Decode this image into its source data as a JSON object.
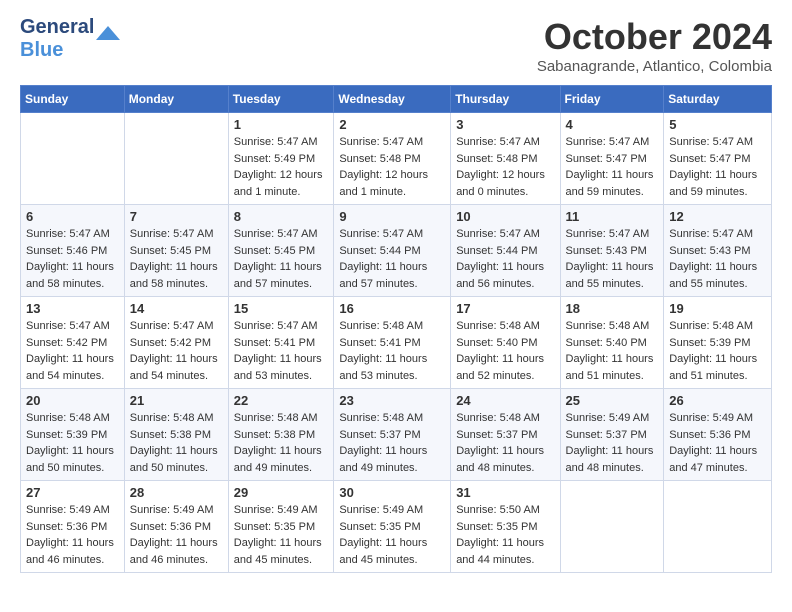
{
  "logo": {
    "line1": "General",
    "line2": "Blue"
  },
  "title": "October 2024",
  "subtitle": "Sabanagrande, Atlantico, Colombia",
  "days_of_week": [
    "Sunday",
    "Monday",
    "Tuesday",
    "Wednesday",
    "Thursday",
    "Friday",
    "Saturday"
  ],
  "weeks": [
    [
      {
        "day": "",
        "sunrise": "",
        "sunset": "",
        "daylight": ""
      },
      {
        "day": "",
        "sunrise": "",
        "sunset": "",
        "daylight": ""
      },
      {
        "day": "1",
        "sunrise": "Sunrise: 5:47 AM",
        "sunset": "Sunset: 5:49 PM",
        "daylight": "Daylight: 12 hours and 1 minute."
      },
      {
        "day": "2",
        "sunrise": "Sunrise: 5:47 AM",
        "sunset": "Sunset: 5:48 PM",
        "daylight": "Daylight: 12 hours and 1 minute."
      },
      {
        "day": "3",
        "sunrise": "Sunrise: 5:47 AM",
        "sunset": "Sunset: 5:48 PM",
        "daylight": "Daylight: 12 hours and 0 minutes."
      },
      {
        "day": "4",
        "sunrise": "Sunrise: 5:47 AM",
        "sunset": "Sunset: 5:47 PM",
        "daylight": "Daylight: 11 hours and 59 minutes."
      },
      {
        "day": "5",
        "sunrise": "Sunrise: 5:47 AM",
        "sunset": "Sunset: 5:47 PM",
        "daylight": "Daylight: 11 hours and 59 minutes."
      }
    ],
    [
      {
        "day": "6",
        "sunrise": "Sunrise: 5:47 AM",
        "sunset": "Sunset: 5:46 PM",
        "daylight": "Daylight: 11 hours and 58 minutes."
      },
      {
        "day": "7",
        "sunrise": "Sunrise: 5:47 AM",
        "sunset": "Sunset: 5:45 PM",
        "daylight": "Daylight: 11 hours and 58 minutes."
      },
      {
        "day": "8",
        "sunrise": "Sunrise: 5:47 AM",
        "sunset": "Sunset: 5:45 PM",
        "daylight": "Daylight: 11 hours and 57 minutes."
      },
      {
        "day": "9",
        "sunrise": "Sunrise: 5:47 AM",
        "sunset": "Sunset: 5:44 PM",
        "daylight": "Daylight: 11 hours and 57 minutes."
      },
      {
        "day": "10",
        "sunrise": "Sunrise: 5:47 AM",
        "sunset": "Sunset: 5:44 PM",
        "daylight": "Daylight: 11 hours and 56 minutes."
      },
      {
        "day": "11",
        "sunrise": "Sunrise: 5:47 AM",
        "sunset": "Sunset: 5:43 PM",
        "daylight": "Daylight: 11 hours and 55 minutes."
      },
      {
        "day": "12",
        "sunrise": "Sunrise: 5:47 AM",
        "sunset": "Sunset: 5:43 PM",
        "daylight": "Daylight: 11 hours and 55 minutes."
      }
    ],
    [
      {
        "day": "13",
        "sunrise": "Sunrise: 5:47 AM",
        "sunset": "Sunset: 5:42 PM",
        "daylight": "Daylight: 11 hours and 54 minutes."
      },
      {
        "day": "14",
        "sunrise": "Sunrise: 5:47 AM",
        "sunset": "Sunset: 5:42 PM",
        "daylight": "Daylight: 11 hours and 54 minutes."
      },
      {
        "day": "15",
        "sunrise": "Sunrise: 5:47 AM",
        "sunset": "Sunset: 5:41 PM",
        "daylight": "Daylight: 11 hours and 53 minutes."
      },
      {
        "day": "16",
        "sunrise": "Sunrise: 5:48 AM",
        "sunset": "Sunset: 5:41 PM",
        "daylight": "Daylight: 11 hours and 53 minutes."
      },
      {
        "day": "17",
        "sunrise": "Sunrise: 5:48 AM",
        "sunset": "Sunset: 5:40 PM",
        "daylight": "Daylight: 11 hours and 52 minutes."
      },
      {
        "day": "18",
        "sunrise": "Sunrise: 5:48 AM",
        "sunset": "Sunset: 5:40 PM",
        "daylight": "Daylight: 11 hours and 51 minutes."
      },
      {
        "day": "19",
        "sunrise": "Sunrise: 5:48 AM",
        "sunset": "Sunset: 5:39 PM",
        "daylight": "Daylight: 11 hours and 51 minutes."
      }
    ],
    [
      {
        "day": "20",
        "sunrise": "Sunrise: 5:48 AM",
        "sunset": "Sunset: 5:39 PM",
        "daylight": "Daylight: 11 hours and 50 minutes."
      },
      {
        "day": "21",
        "sunrise": "Sunrise: 5:48 AM",
        "sunset": "Sunset: 5:38 PM",
        "daylight": "Daylight: 11 hours and 50 minutes."
      },
      {
        "day": "22",
        "sunrise": "Sunrise: 5:48 AM",
        "sunset": "Sunset: 5:38 PM",
        "daylight": "Daylight: 11 hours and 49 minutes."
      },
      {
        "day": "23",
        "sunrise": "Sunrise: 5:48 AM",
        "sunset": "Sunset: 5:37 PM",
        "daylight": "Daylight: 11 hours and 49 minutes."
      },
      {
        "day": "24",
        "sunrise": "Sunrise: 5:48 AM",
        "sunset": "Sunset: 5:37 PM",
        "daylight": "Daylight: 11 hours and 48 minutes."
      },
      {
        "day": "25",
        "sunrise": "Sunrise: 5:49 AM",
        "sunset": "Sunset: 5:37 PM",
        "daylight": "Daylight: 11 hours and 48 minutes."
      },
      {
        "day": "26",
        "sunrise": "Sunrise: 5:49 AM",
        "sunset": "Sunset: 5:36 PM",
        "daylight": "Daylight: 11 hours and 47 minutes."
      }
    ],
    [
      {
        "day": "27",
        "sunrise": "Sunrise: 5:49 AM",
        "sunset": "Sunset: 5:36 PM",
        "daylight": "Daylight: 11 hours and 46 minutes."
      },
      {
        "day": "28",
        "sunrise": "Sunrise: 5:49 AM",
        "sunset": "Sunset: 5:36 PM",
        "daylight": "Daylight: 11 hours and 46 minutes."
      },
      {
        "day": "29",
        "sunrise": "Sunrise: 5:49 AM",
        "sunset": "Sunset: 5:35 PM",
        "daylight": "Daylight: 11 hours and 45 minutes."
      },
      {
        "day": "30",
        "sunrise": "Sunrise: 5:49 AM",
        "sunset": "Sunset: 5:35 PM",
        "daylight": "Daylight: 11 hours and 45 minutes."
      },
      {
        "day": "31",
        "sunrise": "Sunrise: 5:50 AM",
        "sunset": "Sunset: 5:35 PM",
        "daylight": "Daylight: 11 hours and 44 minutes."
      },
      {
        "day": "",
        "sunrise": "",
        "sunset": "",
        "daylight": ""
      },
      {
        "day": "",
        "sunrise": "",
        "sunset": "",
        "daylight": ""
      }
    ]
  ]
}
